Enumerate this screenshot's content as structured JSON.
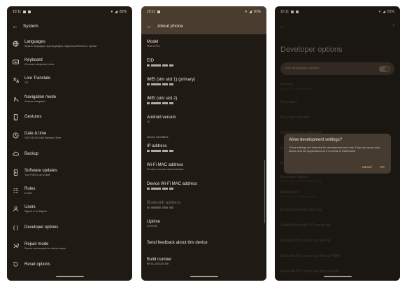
{
  "status": {
    "time": "10:11",
    "battery": "81%"
  },
  "panel1": {
    "title": "System",
    "items": [
      {
        "icon": "globe-icon",
        "label": "Languages",
        "sub": "System languages, app languages, regional preferences, speech"
      },
      {
        "icon": "keyboard-icon",
        "label": "Keyboard",
        "sub": "On-screen keyboard, tools"
      },
      {
        "icon": "translate-icon",
        "label": "Live Translate",
        "sub": "Off"
      },
      {
        "icon": "gesture-icon",
        "label": "Navigation mode",
        "sub": "Gesture navigation"
      },
      {
        "icon": "phone-gesture-icon",
        "label": "Gestures",
        "sub": ""
      },
      {
        "icon": "clock-icon",
        "label": "Date & time",
        "sub": "GMT+05:30 India Standard Time"
      },
      {
        "icon": "cloud-icon",
        "label": "Backup",
        "sub": ""
      },
      {
        "icon": "update-icon",
        "label": "Software updates",
        "sub": "Your Pixel is up to date"
      },
      {
        "icon": "rules-icon",
        "label": "Rules",
        "sub": "0 rules"
      },
      {
        "icon": "users-icon",
        "label": "Users",
        "sub": "Signed in as Rajesh"
      },
      {
        "icon": "braces-icon",
        "label": "Developer options",
        "sub": ""
      },
      {
        "icon": "tools-icon",
        "label": "Repair mode",
        "sub": "Secure environment for device repair"
      },
      {
        "icon": "reset-icon",
        "label": "Reset options",
        "sub": ""
      }
    ]
  },
  "panel2": {
    "title": "About phone",
    "rows": [
      {
        "label": "Model",
        "value": "Pixel 8 Pro"
      },
      {
        "label": "EID",
        "value": ""
      },
      {
        "label": "IMEI (sim slot 1) (primary)",
        "value": ""
      },
      {
        "label": "IMEI (sim slot 2)",
        "value": ""
      },
      {
        "label": "Android version",
        "value": "15"
      }
    ],
    "section": "Device identifiers",
    "rows2": [
      {
        "label": "IP address",
        "value": ""
      },
      {
        "label": "Wi-Fi MAC address",
        "value": "To view, choose saved network"
      },
      {
        "label": "Device Wi-Fi MAC address",
        "value": ""
      },
      {
        "label": "Bluetooth address",
        "value": ""
      },
      {
        "label": "Uptime",
        "value": "23:00:36"
      },
      {
        "label": "Send feedback about this device",
        "value": ""
      },
      {
        "label": "Build number",
        "value": "BP1A.240225.006"
      }
    ]
  },
  "panel3": {
    "title": "Developer options",
    "toggle_label": "Use developer options",
    "background": [
      {
        "label": "Memory",
        "sub": "Avg 3.1 GB of memory used"
      },
      {
        "label": "Bug report",
        "sub": ""
      },
      {
        "label": "Bug report handler",
        "sub": ""
      },
      {
        "label": "Desktop backup password",
        "sub": ""
      },
      {
        "label": "Stay awake",
        "sub": ""
      },
      {
        "label": "Developer Settings",
        "sub": ""
      },
      {
        "label": "Developer options",
        "sub": "Screen will never sleep while charging"
      },
      {
        "label": "Wake-locks",
        "sub": "Ensure device is never sleeping"
      },
      {
        "label": "Enable Bluetooth stack log",
        "sub": ""
      },
      {
        "label": "Enable Bluetooth HCI snoop log",
        "sub": ""
      },
      {
        "label": "Bluetooth HCI snoop log filtering",
        "sub": ""
      },
      {
        "label": "Bluetooth HCI snoop log filtering PBAP",
        "sub": ""
      },
      {
        "label": "Bluetooth HCI snoop log filtering MAP",
        "sub": ""
      }
    ],
    "dialog": {
      "title": "Allow development settings?",
      "body": "These settings are intended for development use only. They can cause your device and the applications on it to break or misbehave.",
      "cancel": "Cancel",
      "ok": "OK"
    }
  }
}
